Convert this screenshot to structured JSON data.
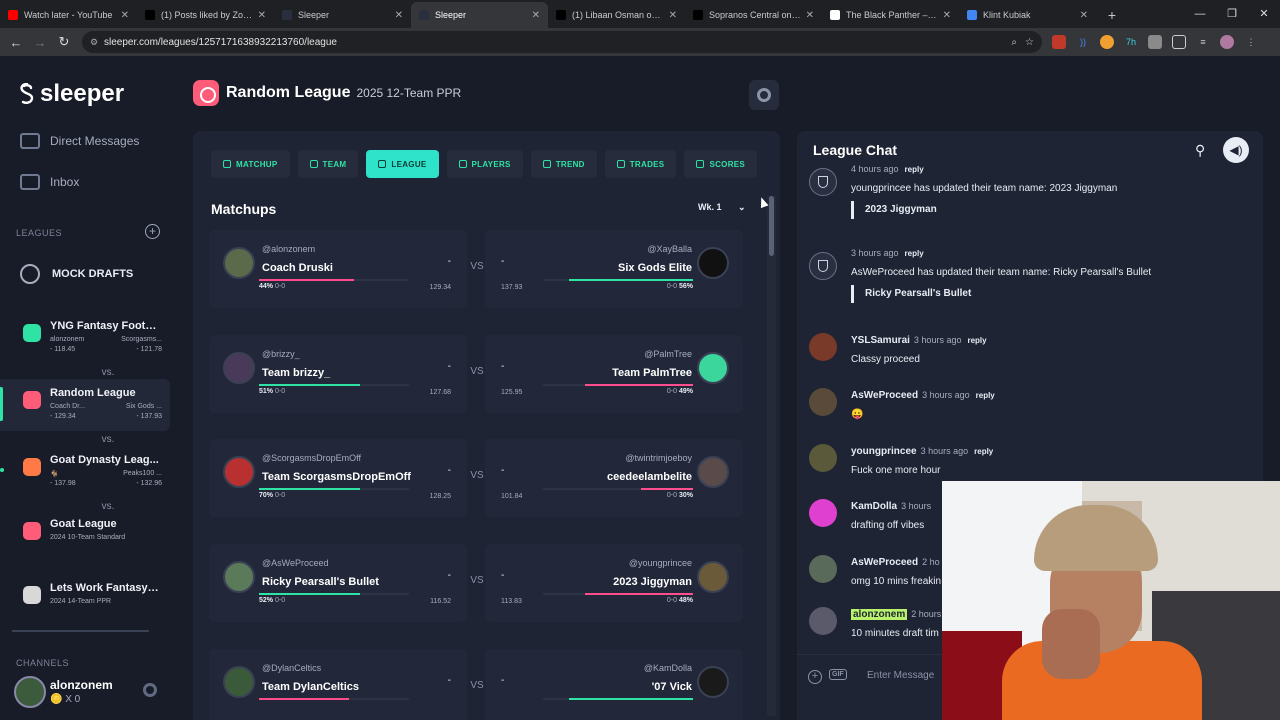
{
  "browser": {
    "tabs": [
      {
        "title": "Watch later - YouTube",
        "color": "#ff0000",
        "active": false
      },
      {
        "title": "(1) Posts liked by Zo 🎒 (",
        "color": "#000000",
        "active": false
      },
      {
        "title": "Sleeper",
        "color": "#2a2f3f",
        "active": false
      },
      {
        "title": "Sleeper",
        "color": "#2a2f3f",
        "active": true
      },
      {
        "title": "(1) Libaan Osman on X: \"y",
        "color": "#000000",
        "active": false
      },
      {
        "title": "Sopranos Central on X: \"I",
        "color": "#000000",
        "active": false
      },
      {
        "title": "The Black Panther – Goo",
        "color": "#ffffff",
        "active": false
      },
      {
        "title": "Klint Kubiak",
        "color": "#4285f4",
        "active": false
      }
    ],
    "url": "sleeper.com/leagues/1257171638932213760/league"
  },
  "sidebar": {
    "logo": "sleeper",
    "direct_messages": "Direct Messages",
    "inbox": "Inbox",
    "leagues_label": "LEAGUES",
    "mock_drafts": "MOCK DRAFTS",
    "leagues": [
      {
        "name": "YNG Fantasy Footb...",
        "team_a": "alonzonem",
        "vs": "vs.",
        "team_b": "Scorgasms...",
        "score_a": "- 118.45",
        "score_b": "- 121.78",
        "color": "#2ee3a4",
        "selected": false
      },
      {
        "name": "Random League",
        "team_a": "Coach Dr...",
        "vs": "vs.",
        "team_b": "Six Gods ...",
        "score_a": "- 129.34",
        "score_b": "- 137.93",
        "color": "#ff5c7a",
        "selected": true
      },
      {
        "name": "Goat Dynasty Leag...",
        "team_a": "🐐",
        "vs": "vs.",
        "team_b": "Peaks100 ...",
        "score_a": "- 137.98",
        "score_b": "- 132.96",
        "color": "#ff7a45",
        "selected": false
      },
      {
        "name": "Goat League",
        "sub": "2024 10-Team Standard",
        "color": "#ff5c7a",
        "selected": false
      },
      {
        "name": "Lets Work Fantasy L...",
        "sub": "2024 14-Team PPR",
        "color": "#d8d8d8",
        "selected": false
      }
    ],
    "channels_label": "CHANNELS",
    "username": "alonzonem",
    "balance": "🪙 X 0"
  },
  "header": {
    "league_name": "Random League",
    "league_sub": "2025 12-Team PPR"
  },
  "tabs": [
    "MATCHUP",
    "TEAM",
    "LEAGUE",
    "PLAYERS",
    "TREND",
    "TRADES",
    "SCORES"
  ],
  "matchups": {
    "title": "Matchups",
    "week": "Wk. 1",
    "vs": "VS",
    "games": [
      {
        "left": {
          "handle": "@alonzonem",
          "team": "Coach Druski",
          "score": "-",
          "pct": "44%",
          "record": "0-0",
          "proj": "129.34",
          "bar": 0.63,
          "bar_color": "#ff4d8d",
          "avatar_color": "#5a6a4a"
        },
        "right": {
          "handle": "@XayBalla",
          "team": "Six Gods Elite",
          "score": "-",
          "pct": "56%",
          "record": "0-0",
          "proj": "137.93",
          "bar": 0.83,
          "bar_color": "#2ee3a4",
          "avatar_color": "#111111"
        }
      },
      {
        "left": {
          "handle": "@brizzy_",
          "team": "Team brizzy_",
          "score": "-",
          "pct": "51%",
          "record": "0-0",
          "proj": "127.68",
          "bar": 0.67,
          "bar_color": "#2ee3a4",
          "avatar_color": "#4a3a5a"
        },
        "right": {
          "handle": "@PalmTree",
          "team": "Team PalmTree",
          "score": "-",
          "pct": "49%",
          "record": "0-0",
          "proj": "125.95",
          "bar": 0.72,
          "bar_color": "#ff4d8d",
          "avatar_color": "#3ad69c"
        }
      },
      {
        "left": {
          "handle": "@ScorgasmsDropEmOff",
          "team": "Team ScorgasmsDropEmOff",
          "score": "-",
          "pct": "70%",
          "record": "0-0",
          "proj": "128.25",
          "bar": 0.67,
          "bar_color": "#2ee3a4",
          "avatar_color": "#b83030"
        },
        "right": {
          "handle": "@twintrimjoeboy",
          "team": "ceedeelambelite",
          "score": "-",
          "pct": "30%",
          "record": "0-0",
          "proj": "101.84",
          "bar": 0.35,
          "bar_color": "#ff4d8d",
          "avatar_color": "#5a4a4a"
        }
      },
      {
        "left": {
          "handle": "@AsWeProceed",
          "team": "Ricky Pearsall's Bullet",
          "score": "-",
          "pct": "52%",
          "record": "0-0",
          "proj": "116.52",
          "bar": 0.67,
          "bar_color": "#2ee3a4",
          "avatar_color": "#5a7a5a"
        },
        "right": {
          "handle": "@youngprincee",
          "team": "2023 Jiggyman",
          "score": "-",
          "pct": "48%",
          "record": "0-0",
          "proj": "113.83",
          "bar": 0.72,
          "bar_color": "#ff4d8d",
          "avatar_color": "#6a5a3a"
        }
      },
      {
        "left": {
          "handle": "@DylanCeltics",
          "team": "Team DylanCeltics",
          "score": "-",
          "pct": "",
          "record": "",
          "proj": "",
          "bar": 0.6,
          "bar_color": "#ff4d8d",
          "avatar_color": "#3a5a3a"
        },
        "right": {
          "handle": "@KamDolla",
          "team": "'07 Vick",
          "score": "-",
          "pct": "",
          "record": "",
          "proj": "",
          "bar": 0.83,
          "bar_color": "#2ee3a4",
          "avatar_color": "#1a1a1a"
        }
      }
    ]
  },
  "chat": {
    "title": "League Chat",
    "placeholder": "Enter Message",
    "gif": "GIF",
    "messages": [
      {
        "system": true,
        "time": "4 hours ago",
        "reply": "reply",
        "body": "youngprincee has updated their team name: 2023 Jiggyman",
        "quote": "2023 Jiggyman"
      },
      {
        "system": true,
        "time": "3 hours ago",
        "reply": "reply",
        "body": "AsWeProceed has updated their team name: Ricky Pearsall's Bullet",
        "quote": "Ricky Pearsall's Bullet"
      },
      {
        "who": "YSLSamurai",
        "time": "3 hours ago",
        "reply": "reply",
        "body": "Classy proceed",
        "avatar_color": "#7a3a2a"
      },
      {
        "who": "AsWeProceed",
        "time": "3 hours ago",
        "reply": "reply",
        "body": "😛",
        "avatar_color": "#5a4a3a"
      },
      {
        "who": "youngprincee",
        "time": "3 hours ago",
        "reply": "reply",
        "body": "Fuck one more hour",
        "avatar_color": "#5a5a3a"
      },
      {
        "who": "KamDolla",
        "time": "3 hours",
        "reply": "",
        "body": "drafting off vibes",
        "avatar_color": "#e040d0"
      },
      {
        "who": "AsWeProceed",
        "time": "2 ho",
        "reply": "",
        "body": "omg 10 mins freakin",
        "avatar_color": "#5a6a5a"
      },
      {
        "who": "alonzonem",
        "time": "2 hours",
        "reply": "",
        "body": "10 minutes draft tim",
        "avatar_color": "#5a5a6a",
        "highlight": true
      }
    ]
  }
}
